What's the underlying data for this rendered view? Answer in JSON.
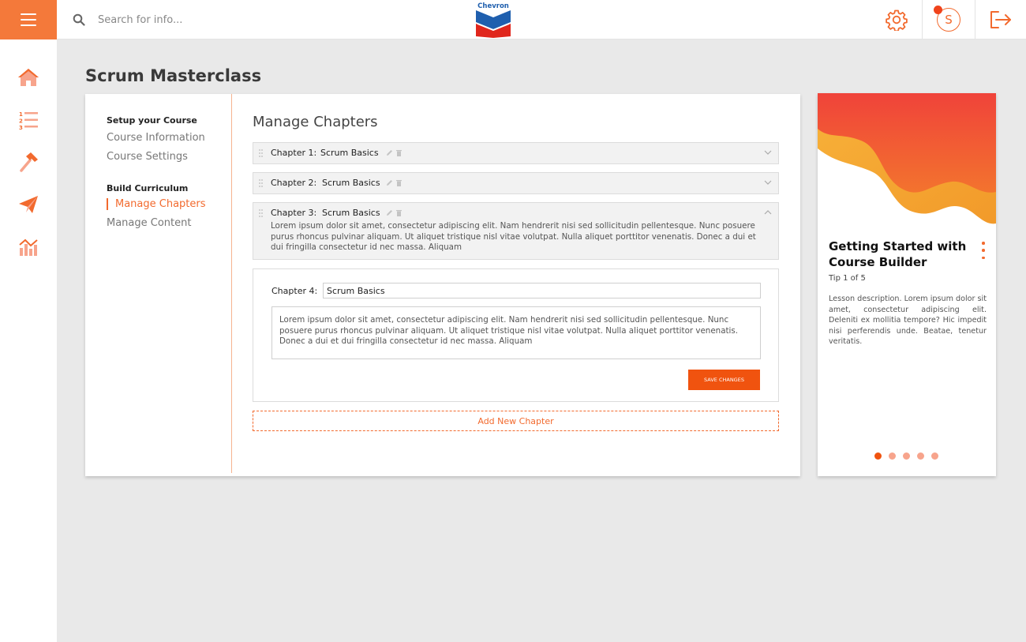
{
  "colors": {
    "accent": "#f26a2e",
    "accent_dark": "#f0530f",
    "accent_light": "#f7a48c"
  },
  "search": {
    "placeholder": "Search for info..."
  },
  "logo": {
    "name": "Chevron"
  },
  "avatar": {
    "initial": "S"
  },
  "sidebar": {
    "items": [
      {
        "icon": "home-icon"
      },
      {
        "icon": "numbered-list-icon"
      },
      {
        "icon": "hammer-icon"
      },
      {
        "icon": "paper-plane-icon"
      },
      {
        "icon": "analytics-chart-icon"
      }
    ]
  },
  "page": {
    "title": "Scrum Masterclass"
  },
  "course_menu": {
    "setup_heading": "Setup your Course",
    "setup_items": [
      "Course Information",
      "Course Settings"
    ],
    "build_heading": "Build Curriculum",
    "build_items": [
      "Manage Chapters",
      "Manage Content"
    ],
    "active_item": "Manage Chapters"
  },
  "chapters": {
    "heading": "Manage Chapters",
    "list": [
      {
        "label": "Chapter 1:",
        "name": "Scrum Basics",
        "expanded": false
      },
      {
        "label": "Chapter 2:",
        "name": "Scrum Basics",
        "expanded": false
      },
      {
        "label": "Chapter 3:",
        "name": "Scrum Basics",
        "expanded": true,
        "description": "Lorem ipsum dolor sit amet, consectetur adipiscing elit. Nam hendrerit nisi sed sollicitudin pellentesque. Nunc posuere purus rhoncus pulvinar aliquam. Ut aliquet tristique nisl vitae volutpat. Nulla aliquet porttitor venenatis. Donec a dui et dui fringilla consectetur id nec massa. Aliquam"
      }
    ],
    "editor": {
      "label": "Chapter 4:",
      "name_value": "Scrum Basics",
      "description_value": "Lorem ipsum dolor sit amet, consectetur adipiscing elit. Nam hendrerit nisi sed sollicitudin pellentesque. Nunc posuere purus rhoncus pulvinar aliquam. Ut aliquet tristique nisl vitae volutpat. Nulla aliquet porttitor venenatis. Donec a dui et dui fringilla consectetur id nec massa. Aliquam",
      "save_label": "Save Changes"
    },
    "add_label": "Add New Chapter"
  },
  "tip": {
    "title": "Getting Started with Course Builder",
    "count": "Tip 1 of 5",
    "description": "Lesson description. Lorem ipsum dolor sit amet, consectetur adipiscing elit. Deleniti ex mollitia tempore? Hic impedit nisi perferendis unde. Beatae, tenetur veritatis.",
    "total": 5,
    "current": 1
  }
}
